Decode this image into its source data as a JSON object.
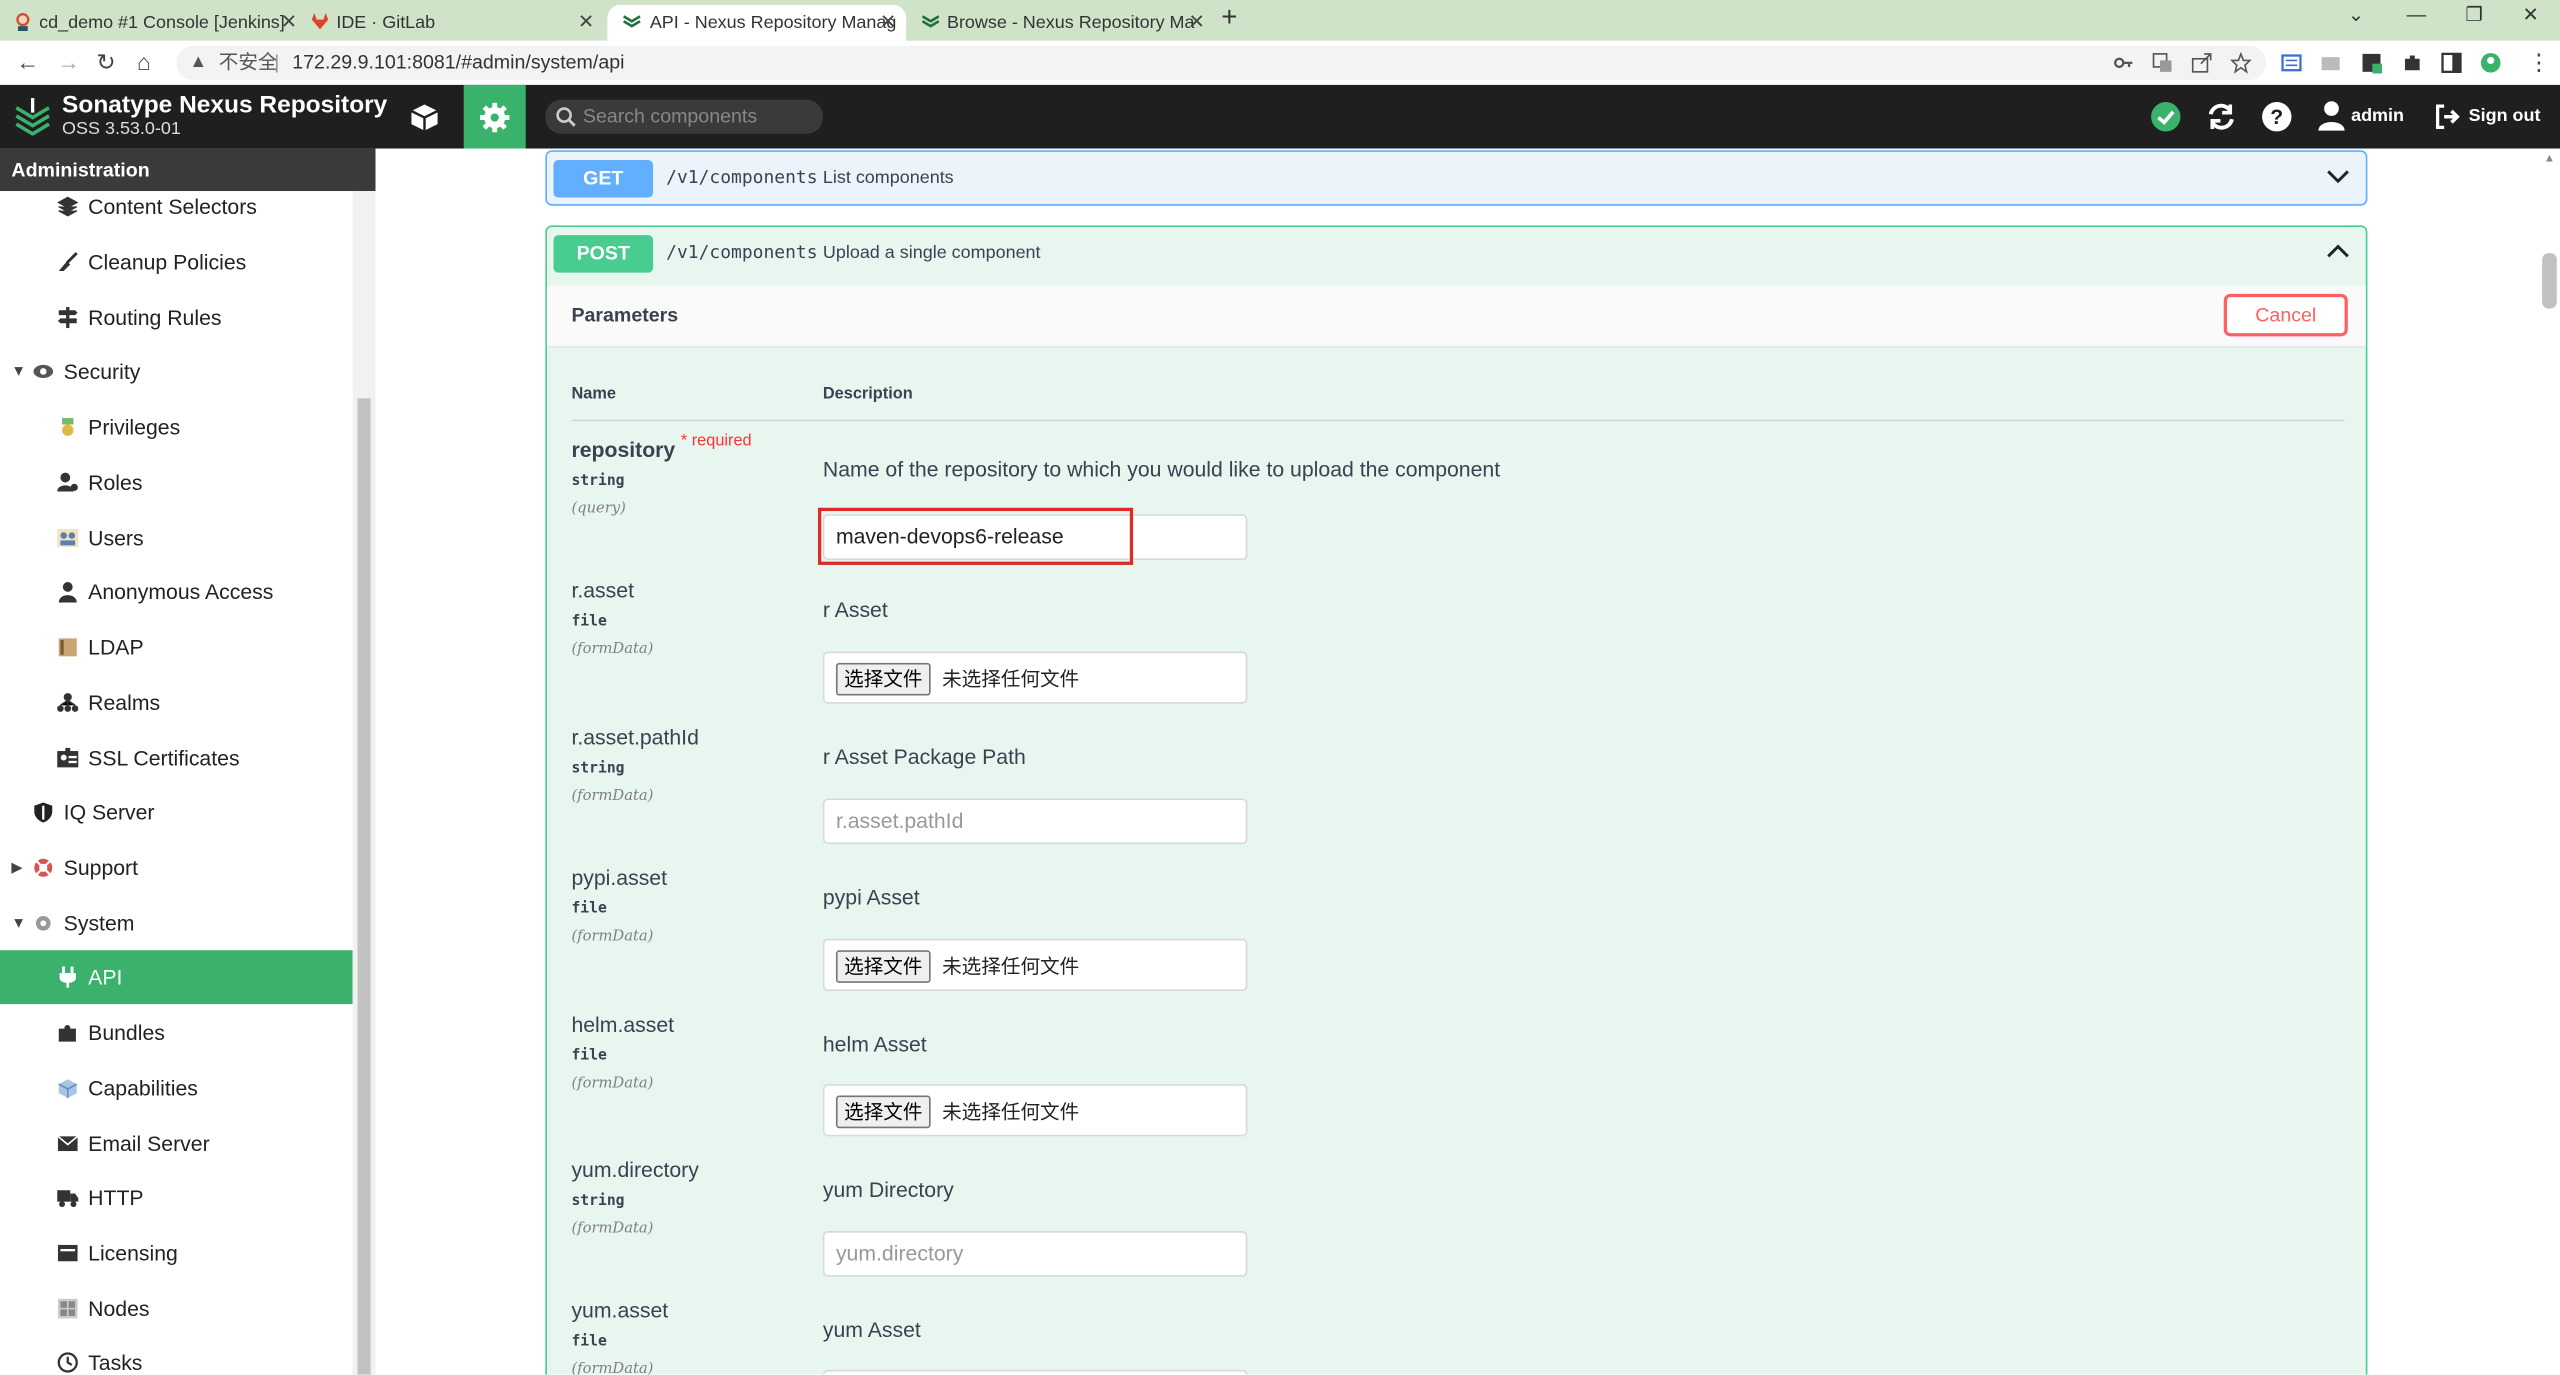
{
  "browser": {
    "tabs": [
      {
        "title": "cd_demo #1 Console [Jenkins]",
        "icon": "jenkins-icon",
        "active": false
      },
      {
        "title": "IDE · GitLab",
        "icon": "gitlab-icon",
        "active": false
      },
      {
        "title": "API - Nexus Repository Manag",
        "icon": "nexus-icon",
        "active": true
      },
      {
        "title": "Browse - Nexus Repository Ma",
        "icon": "nexus-icon",
        "active": false
      }
    ],
    "insecure_label": "不安全",
    "url": "172.29.9.101:8081/#admin/system/api"
  },
  "header": {
    "brand": "Sonatype Nexus Repository",
    "version": "OSS 3.53.0-01",
    "search_placeholder": "Search components",
    "user": "admin",
    "signout": "Sign out"
  },
  "sidebar": {
    "title": "Administration",
    "items": [
      {
        "label": "Content Selectors",
        "icon": "layers-icon",
        "level": 2
      },
      {
        "label": "Cleanup Policies",
        "icon": "broom-icon",
        "level": 2
      },
      {
        "label": "Routing Rules",
        "icon": "signpost-icon",
        "level": 2
      },
      {
        "label": "Security",
        "icon": "eye-icon",
        "level": 1,
        "expanded": true
      },
      {
        "label": "Privileges",
        "icon": "medal-icon",
        "level": 2
      },
      {
        "label": "Roles",
        "icon": "user-gear-icon",
        "level": 2
      },
      {
        "label": "Users",
        "icon": "users-icon",
        "level": 2
      },
      {
        "label": "Anonymous Access",
        "icon": "user-icon",
        "level": 2
      },
      {
        "label": "LDAP",
        "icon": "book-icon",
        "level": 2
      },
      {
        "label": "Realms",
        "icon": "sitemap-icon",
        "level": 2
      },
      {
        "label": "SSL Certificates",
        "icon": "id-card-icon",
        "level": 2
      },
      {
        "label": "IQ Server",
        "icon": "shield-icon",
        "level": 1
      },
      {
        "label": "Support",
        "icon": "lifebuoy-icon",
        "level": 1,
        "expanded": false
      },
      {
        "label": "System",
        "icon": "gear-icon",
        "level": 1,
        "expanded": true
      },
      {
        "label": "API",
        "icon": "plug-icon",
        "level": 2,
        "selected": true
      },
      {
        "label": "Bundles",
        "icon": "puzzle-icon",
        "level": 2
      },
      {
        "label": "Capabilities",
        "icon": "cube-icon",
        "level": 2
      },
      {
        "label": "Email Server",
        "icon": "envelope-icon",
        "level": 2
      },
      {
        "label": "HTTP",
        "icon": "truck-icon",
        "level": 2
      },
      {
        "label": "Licensing",
        "icon": "license-icon",
        "level": 2
      },
      {
        "label": "Nodes",
        "icon": "nodes-icon",
        "level": 2
      },
      {
        "label": "Tasks",
        "icon": "clock-icon",
        "level": 2
      }
    ]
  },
  "api": {
    "get_op": {
      "method": "GET",
      "path": "/v1/components",
      "summary": "List components"
    },
    "post_op": {
      "method": "POST",
      "path": "/v1/components",
      "summary": "Upload a single component"
    },
    "parameters_title": "Parameters",
    "cancel_label": "Cancel",
    "col_name": "Name",
    "col_description": "Description",
    "required_label": "* required",
    "file_button": "选择文件",
    "file_status": "未选择任何文件",
    "params": [
      {
        "name": "repository",
        "type": "string",
        "in": "(query)",
        "required": true,
        "description": "Name of the repository to which you would like to upload the component",
        "value": "maven-devops6-release",
        "input": "text"
      },
      {
        "name": "r.asset",
        "type": "file",
        "in": "(formData)",
        "description": "r Asset",
        "input": "file"
      },
      {
        "name": "r.asset.pathId",
        "type": "string",
        "in": "(formData)",
        "description": "r Asset Package Path",
        "placeholder": "r.asset.pathId",
        "input": "text"
      },
      {
        "name": "pypi.asset",
        "type": "file",
        "in": "(formData)",
        "description": "pypi Asset",
        "input": "file"
      },
      {
        "name": "helm.asset",
        "type": "file",
        "in": "(formData)",
        "description": "helm Asset",
        "input": "file"
      },
      {
        "name": "yum.directory",
        "type": "string",
        "in": "(formData)",
        "description": "yum Directory",
        "placeholder": "yum.directory",
        "input": "text"
      },
      {
        "name": "yum.asset",
        "type": "file",
        "in": "(formData)",
        "description": "yum Asset",
        "input": "file"
      }
    ]
  },
  "colors": {
    "accent_green": "#3ab26b",
    "get_blue": "#61affe",
    "post_green": "#49cc90",
    "cancel_red": "#ff6060",
    "highlight_red": "#e02a2a"
  }
}
